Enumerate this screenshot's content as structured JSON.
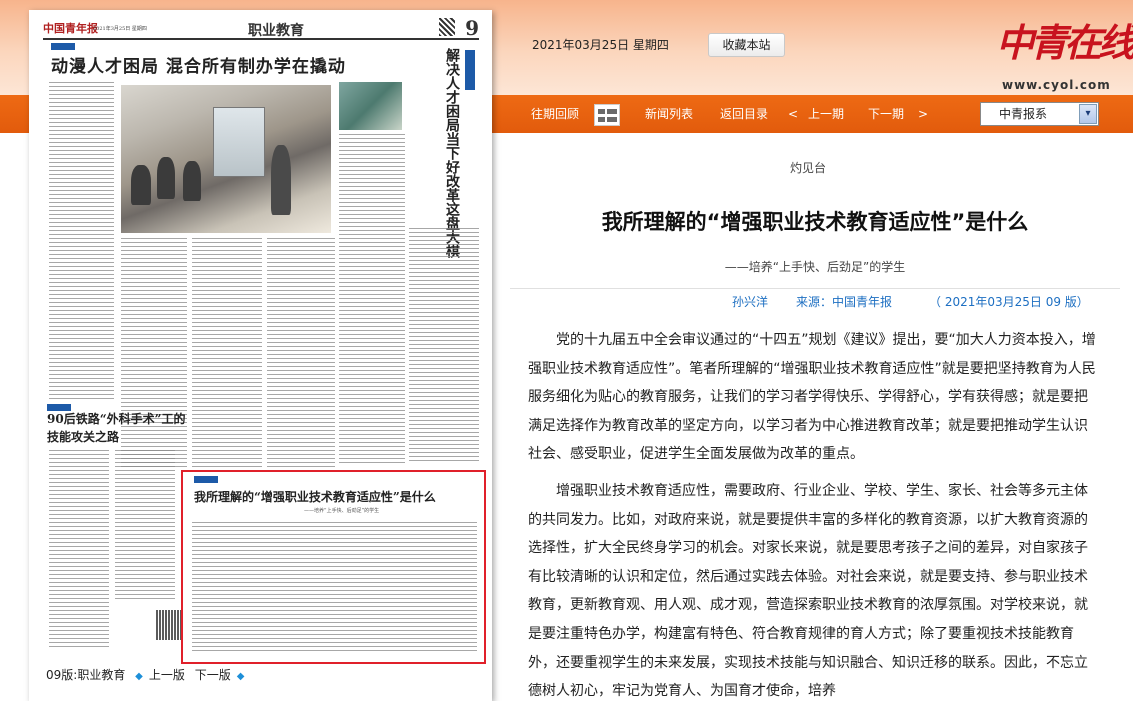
{
  "header": {
    "date": "2021年03月25日 星期四",
    "favorite_button": "收藏本站",
    "brand_cn": "中青在线",
    "brand_url": "www.cyol.com"
  },
  "nav": {
    "archive": "往期回顾",
    "news_list": "新闻列表",
    "back_to_index": "返回目录",
    "prev_issue_arrow": "<",
    "prev_issue": "上一期",
    "next_issue": "下一期",
    "next_issue_arrow": ">",
    "select_value": "中青报系",
    "select_arrow": "▾"
  },
  "newspaper": {
    "masthead": "中国青年报",
    "date_line": "2021年3月25日 星期四",
    "section": "职业教育",
    "page_number": "9",
    "headline_main": "动漫人才困局 混合所有制办学在撬动",
    "vertical_headline": "解决人才困局当下好改革这盘大棋",
    "headline_secondary_line1": "90后铁路“外科手术”工的",
    "headline_secondary_line2": "技能攻关之路",
    "highlight_title": "我所理解的“增强职业技术教育适应性”是什么",
    "highlight_subtitle": "——培养“上手快、后劲足”的学生",
    "footer_page": "09版:职业教育",
    "footer_prev_icon": "◆",
    "footer_prev": "上一版",
    "footer_next": "下一版",
    "footer_next_icon": "◆"
  },
  "article": {
    "column": "灼见台",
    "title": "我所理解的“增强职业技术教育适应性”是什么",
    "subtitle": "——培养“上手快、后劲足”的学生",
    "author": "孙兴洋",
    "source": "来源：中国青年报",
    "date_page": "（ 2021年03月25日   09 版）",
    "paragraphs": [
      "党的十九届五中全会审议通过的“十四五”规划《建议》提出，要“加大人力资本投入，增强职业技术教育适应性”。笔者所理解的“增强职业技术教育适应性”就是要把坚持教育为人民服务细化为贴心的教育服务，让我们的学习者学得快乐、学得舒心，学有获得感；就是要把满足选择作为教育改革的坚定方向，以学习者为中心推进教育改革；就是要把推动学生认识社会、感受职业，促进学生全面发展做为改革的重点。",
      "增强职业技术教育适应性，需要政府、行业企业、学校、学生、家长、社会等多元主体的共同发力。比如，对政府来说，就是要提供丰富的多样化的教育资源，以扩大教育资源的选择性，扩大全民终身学习的机会。对家长来说，就是要思考孩子之间的差异，对自家孩子有比较清晰的认识和定位，然后通过实践去体验。对社会来说，就是要支持、参与职业技术教育，更新教育观、用人观、成才观，营造探索职业技术教育的浓厚氛围。对学校来说，就是要注重特色办学，构建富有特色、符合教育规律的育人方式；除了要重视技术技能教育外，还要重视学生的未来发展，实现技术技能与知识融合、知识迁移的联系。因此，不忘立德树人初心，牢记为党育人、为国育才使命，培养"
    ]
  },
  "colors": {
    "nav_orange": "#e25b0c",
    "brand_red": "#c8131e",
    "meta_blue": "#1d6fc2",
    "highlight_red": "#e0202a"
  }
}
